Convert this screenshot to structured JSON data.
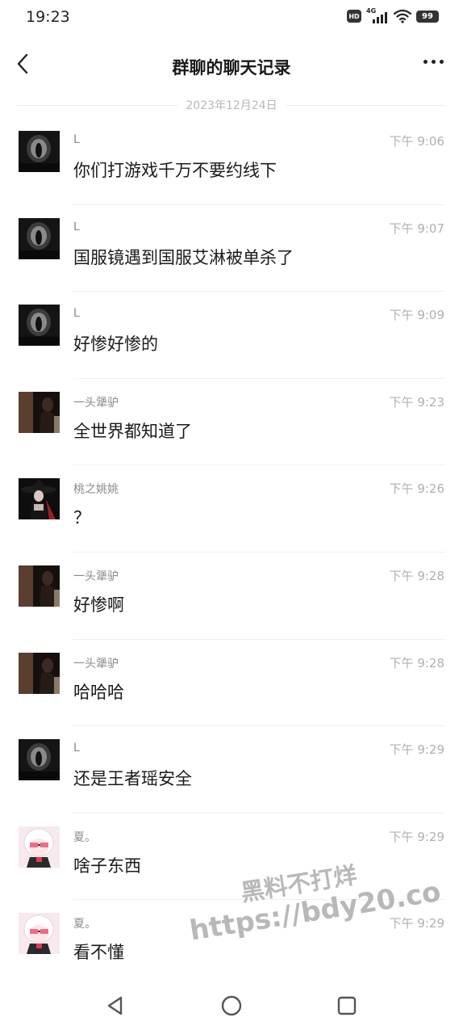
{
  "status_bar": {
    "time": "19:23",
    "hd_label": "HD",
    "network_label": "4G",
    "battery": "99"
  },
  "header": {
    "title": "群聊的聊天记录"
  },
  "date_separator": "2023年12月24日",
  "messages": [
    {
      "sender": "L",
      "time": "下午 9:06",
      "content": "你们打游戏千万不要约线下",
      "avatar": "dark-tunnel-avatar"
    },
    {
      "sender": "L",
      "time": "下午 9:07",
      "content": "国服镜遇到国服艾淋被单杀了",
      "avatar": "dark-tunnel-avatar"
    },
    {
      "sender": "L",
      "time": "下午 9:09",
      "content": "好惨好惨的",
      "avatar": "dark-tunnel-avatar"
    },
    {
      "sender": "一头犟驴",
      "time": "下午 9:23",
      "content": "全世界都知道了",
      "avatar": "shadow-figure-avatar"
    },
    {
      "sender": "桃之姚姚",
      "time": "下午 9:26",
      "content": "？",
      "avatar": "witch-hat-avatar"
    },
    {
      "sender": "一头犟驴",
      "time": "下午 9:28",
      "content": "好惨啊",
      "avatar": "shadow-figure-avatar"
    },
    {
      "sender": "一头犟驴",
      "time": "下午 9:28",
      "content": "哈哈哈",
      "avatar": "shadow-figure-avatar"
    },
    {
      "sender": "L",
      "time": "下午 9:29",
      "content": "还是王者瑶安全",
      "avatar": "dark-tunnel-avatar"
    },
    {
      "sender": "夏。",
      "time": "下午 9:29",
      "content": "啥子东西",
      "avatar": "anime-girl-avatar"
    },
    {
      "sender": "夏。",
      "time": "下午 9:29",
      "content": "看不懂",
      "avatar": "anime-girl-avatar"
    }
  ],
  "watermark": {
    "line1": "黑料不打烊",
    "line2": "https://bdy20.co"
  },
  "nav_bar": {
    "items": [
      "back-triangle-icon",
      "home-circle-icon",
      "recent-square-icon"
    ]
  },
  "colors": {
    "text_primary": "#1a1a1a",
    "text_secondary": "#8a8a8a",
    "time_text": "#b0b0b0",
    "divider": "#f0f0f0",
    "background": "#ffffff"
  }
}
